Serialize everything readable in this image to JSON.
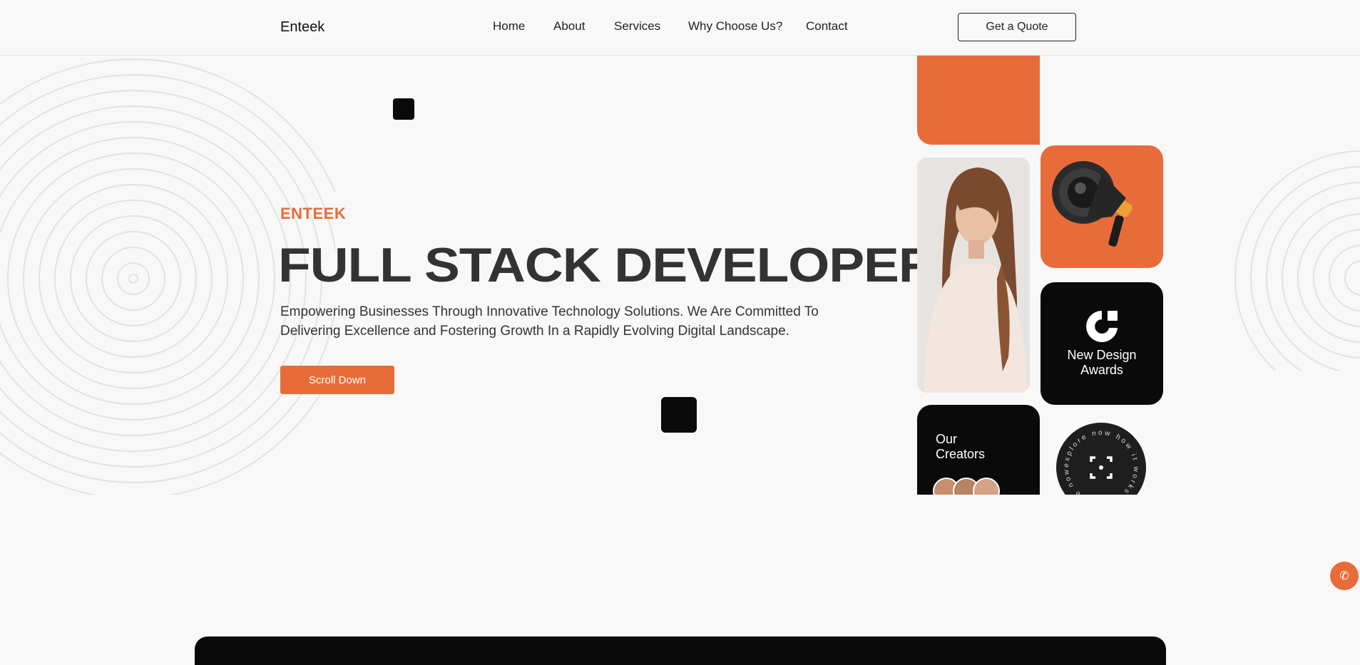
{
  "header": {
    "logo": "Enteek",
    "nav": [
      "Home",
      "About",
      "Services",
      "Why Choose Us?",
      "Contact"
    ],
    "cta_label": "Get a Quote"
  },
  "hero": {
    "eyebrow": "ENTEEK",
    "title": "FULL STACK DEVELOPER",
    "description": "Empowering Businesses Through Innovative Technology Solutions. We Are Committed To Delivering Excellence and Fostering Growth In a Rapidly Evolving Digital Landscape.",
    "button_label": "Scroll Down"
  },
  "showcase": {
    "awards_line1": "New Design",
    "awards_line2": "Awards",
    "creators_line1": "Our",
    "creators_line2": "Creators",
    "badge_ring_text": "explore now how it works • explore now how it works •"
  },
  "icons": {
    "phone": "phone-icon",
    "megaphone": "megaphone-icon",
    "awards_logo": "awards-logo-icon",
    "badge_center": "crosshair-icon"
  },
  "colors": {
    "accent": "#e86c3a",
    "dark": "#0a0a0a",
    "background": "#f8f8f8",
    "text": "#333333"
  }
}
